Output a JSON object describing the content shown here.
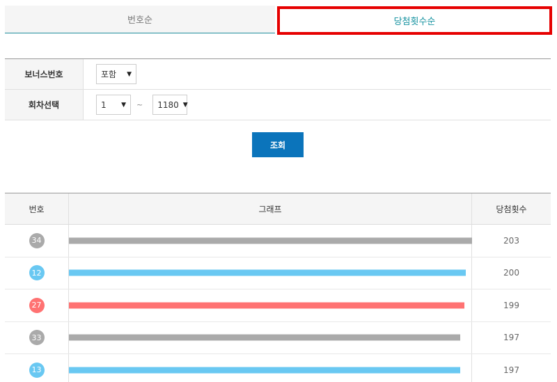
{
  "tabs": {
    "by_number": "번호순",
    "by_wins": "당첨횟수순"
  },
  "filter": {
    "bonus_label": "보너스번호",
    "bonus_value": "포함",
    "round_label": "회차선택",
    "round_from": "1",
    "round_sep": "~",
    "round_to": "1180"
  },
  "search_button": "조회",
  "table": {
    "col_number": "번호",
    "col_graph": "그래프",
    "col_count": "당첨횟수",
    "max_count": 203,
    "rows": [
      {
        "number": "34",
        "count": "203",
        "color": "#aaaaaa"
      },
      {
        "number": "12",
        "count": "200",
        "color": "#69c8f2"
      },
      {
        "number": "27",
        "count": "199",
        "color": "#ff7272"
      },
      {
        "number": "33",
        "count": "197",
        "color": "#aaaaaa"
      },
      {
        "number": "13",
        "count": "197",
        "color": "#69c8f2"
      }
    ]
  }
}
